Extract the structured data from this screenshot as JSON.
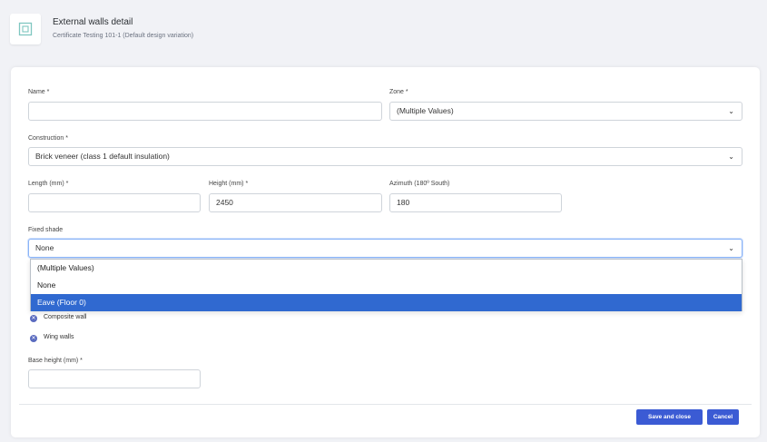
{
  "header": {
    "title": "External walls detail",
    "subtitle": "Certificate Testing 101-1 (Default design variation)",
    "logo_icon": "house-icon"
  },
  "form": {
    "name_label": "Name *",
    "name_value": "",
    "zone_label": "Zone *",
    "zone_value": "(Multiple Values)",
    "construction_label": "Construction *",
    "construction_value": "Brick veneer (class 1 default insulation)",
    "length_label": "Length (mm) *",
    "length_value": "",
    "height_label": "Height (mm) *",
    "height_value": "2450",
    "azimuth_label": "Azimuth (180º South)",
    "azimuth_value": "180",
    "fixed_shade_label": "Fixed shade",
    "fixed_shade_value": "None",
    "fixed_shade_options": [
      "(Multiple Values)",
      "None",
      "Eave (Floor 0)"
    ],
    "highlighted_option": "Eave (Floor 0)",
    "composite_wall_label": "Composite wall",
    "wing_walls_label": "Wing walls",
    "base_height_label": "Base height (mm) *",
    "base_height_value": ""
  },
  "footer": {
    "save_label": "Save and close",
    "cancel_label": "Cancel"
  },
  "colors": {
    "accent": "#3b5bd4",
    "highlight": "#3069d0"
  }
}
